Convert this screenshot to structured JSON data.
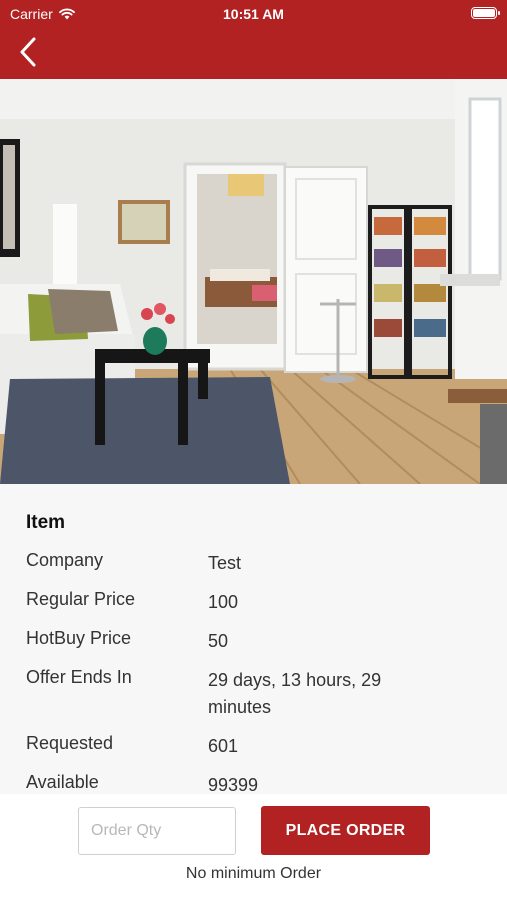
{
  "status_bar": {
    "carrier": "Carrier",
    "time": "10:51 AM"
  },
  "header": {
    "back_icon": "chevron-left-icon",
    "color": "#b22222"
  },
  "item": {
    "title": "Item",
    "rows": [
      {
        "label": "Company",
        "value": "Test"
      },
      {
        "label": "Regular Price",
        "value": "100"
      },
      {
        "label": "HotBuy Price",
        "value": "50"
      },
      {
        "label": "Offer Ends In",
        "value": "29 days, 13 hours, 29 minutes"
      },
      {
        "label": "Requested",
        "value": "601"
      },
      {
        "label": "Available",
        "value": "99399"
      }
    ]
  },
  "order": {
    "qty_placeholder": "Order Qty",
    "place_order_label": "PLACE ORDER",
    "minimum_note": "No minimum Order",
    "accent_color": "#b22222"
  }
}
